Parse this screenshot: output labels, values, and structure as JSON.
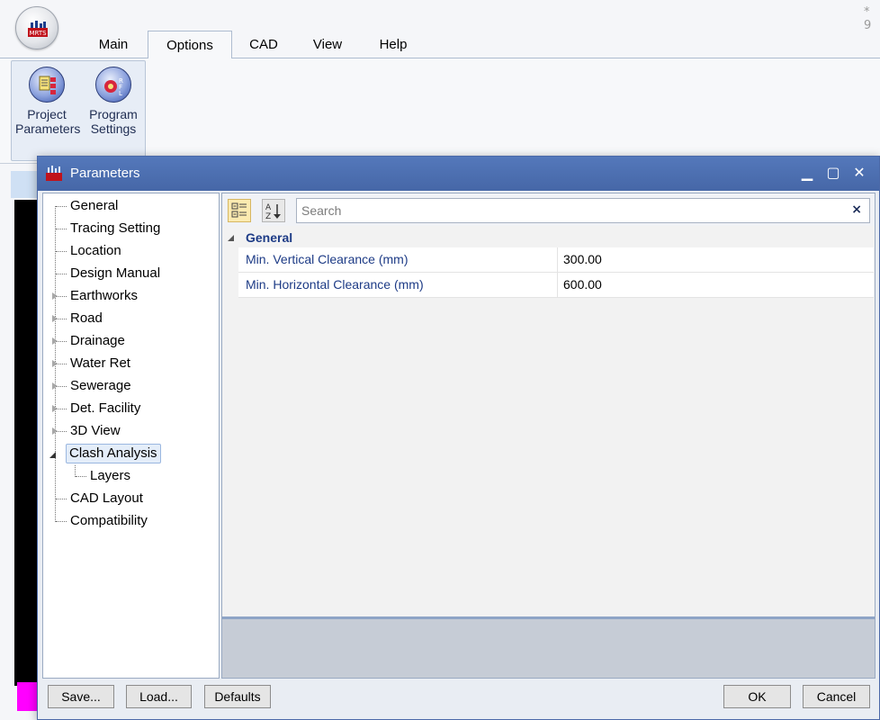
{
  "app": {
    "title_fragment": "* 9",
    "ribbon_tabs": [
      "Main",
      "Options",
      "CAD",
      "View",
      "Help"
    ],
    "active_tab": "Options",
    "ribbon_buttons": [
      {
        "label_line1": "Project",
        "label_line2": "Parameters"
      },
      {
        "label_line1": "Program",
        "label_line2": "Settings"
      }
    ]
  },
  "dialog": {
    "title": "Parameters",
    "tree": [
      "General",
      "Tracing Setting",
      "Location",
      "Design Manual",
      "Earthworks",
      "Road",
      "Drainage",
      "Water Ret",
      "Sewerage",
      "Det. Facility",
      "3D View",
      "Clash Analysis",
      "Layers",
      "CAD Layout",
      "Compatibility"
    ],
    "selected_tree_item": "Clash Analysis",
    "search": {
      "placeholder": "Search",
      "clear_icon": "×"
    },
    "category": "General",
    "properties": [
      {
        "name": "Min. Vertical Clearance (mm)",
        "value": "300.00"
      },
      {
        "name": "Min. Horizontal Clearance (mm)",
        "value": "600.00"
      }
    ],
    "buttons": {
      "save": "Save...",
      "load": "Load...",
      "defaults": "Defaults",
      "ok": "OK",
      "cancel": "Cancel"
    }
  },
  "icons": {
    "alphabetical_glyph": "A\nZ",
    "minimize": "▁",
    "maximize": "▢",
    "close": "✕"
  }
}
